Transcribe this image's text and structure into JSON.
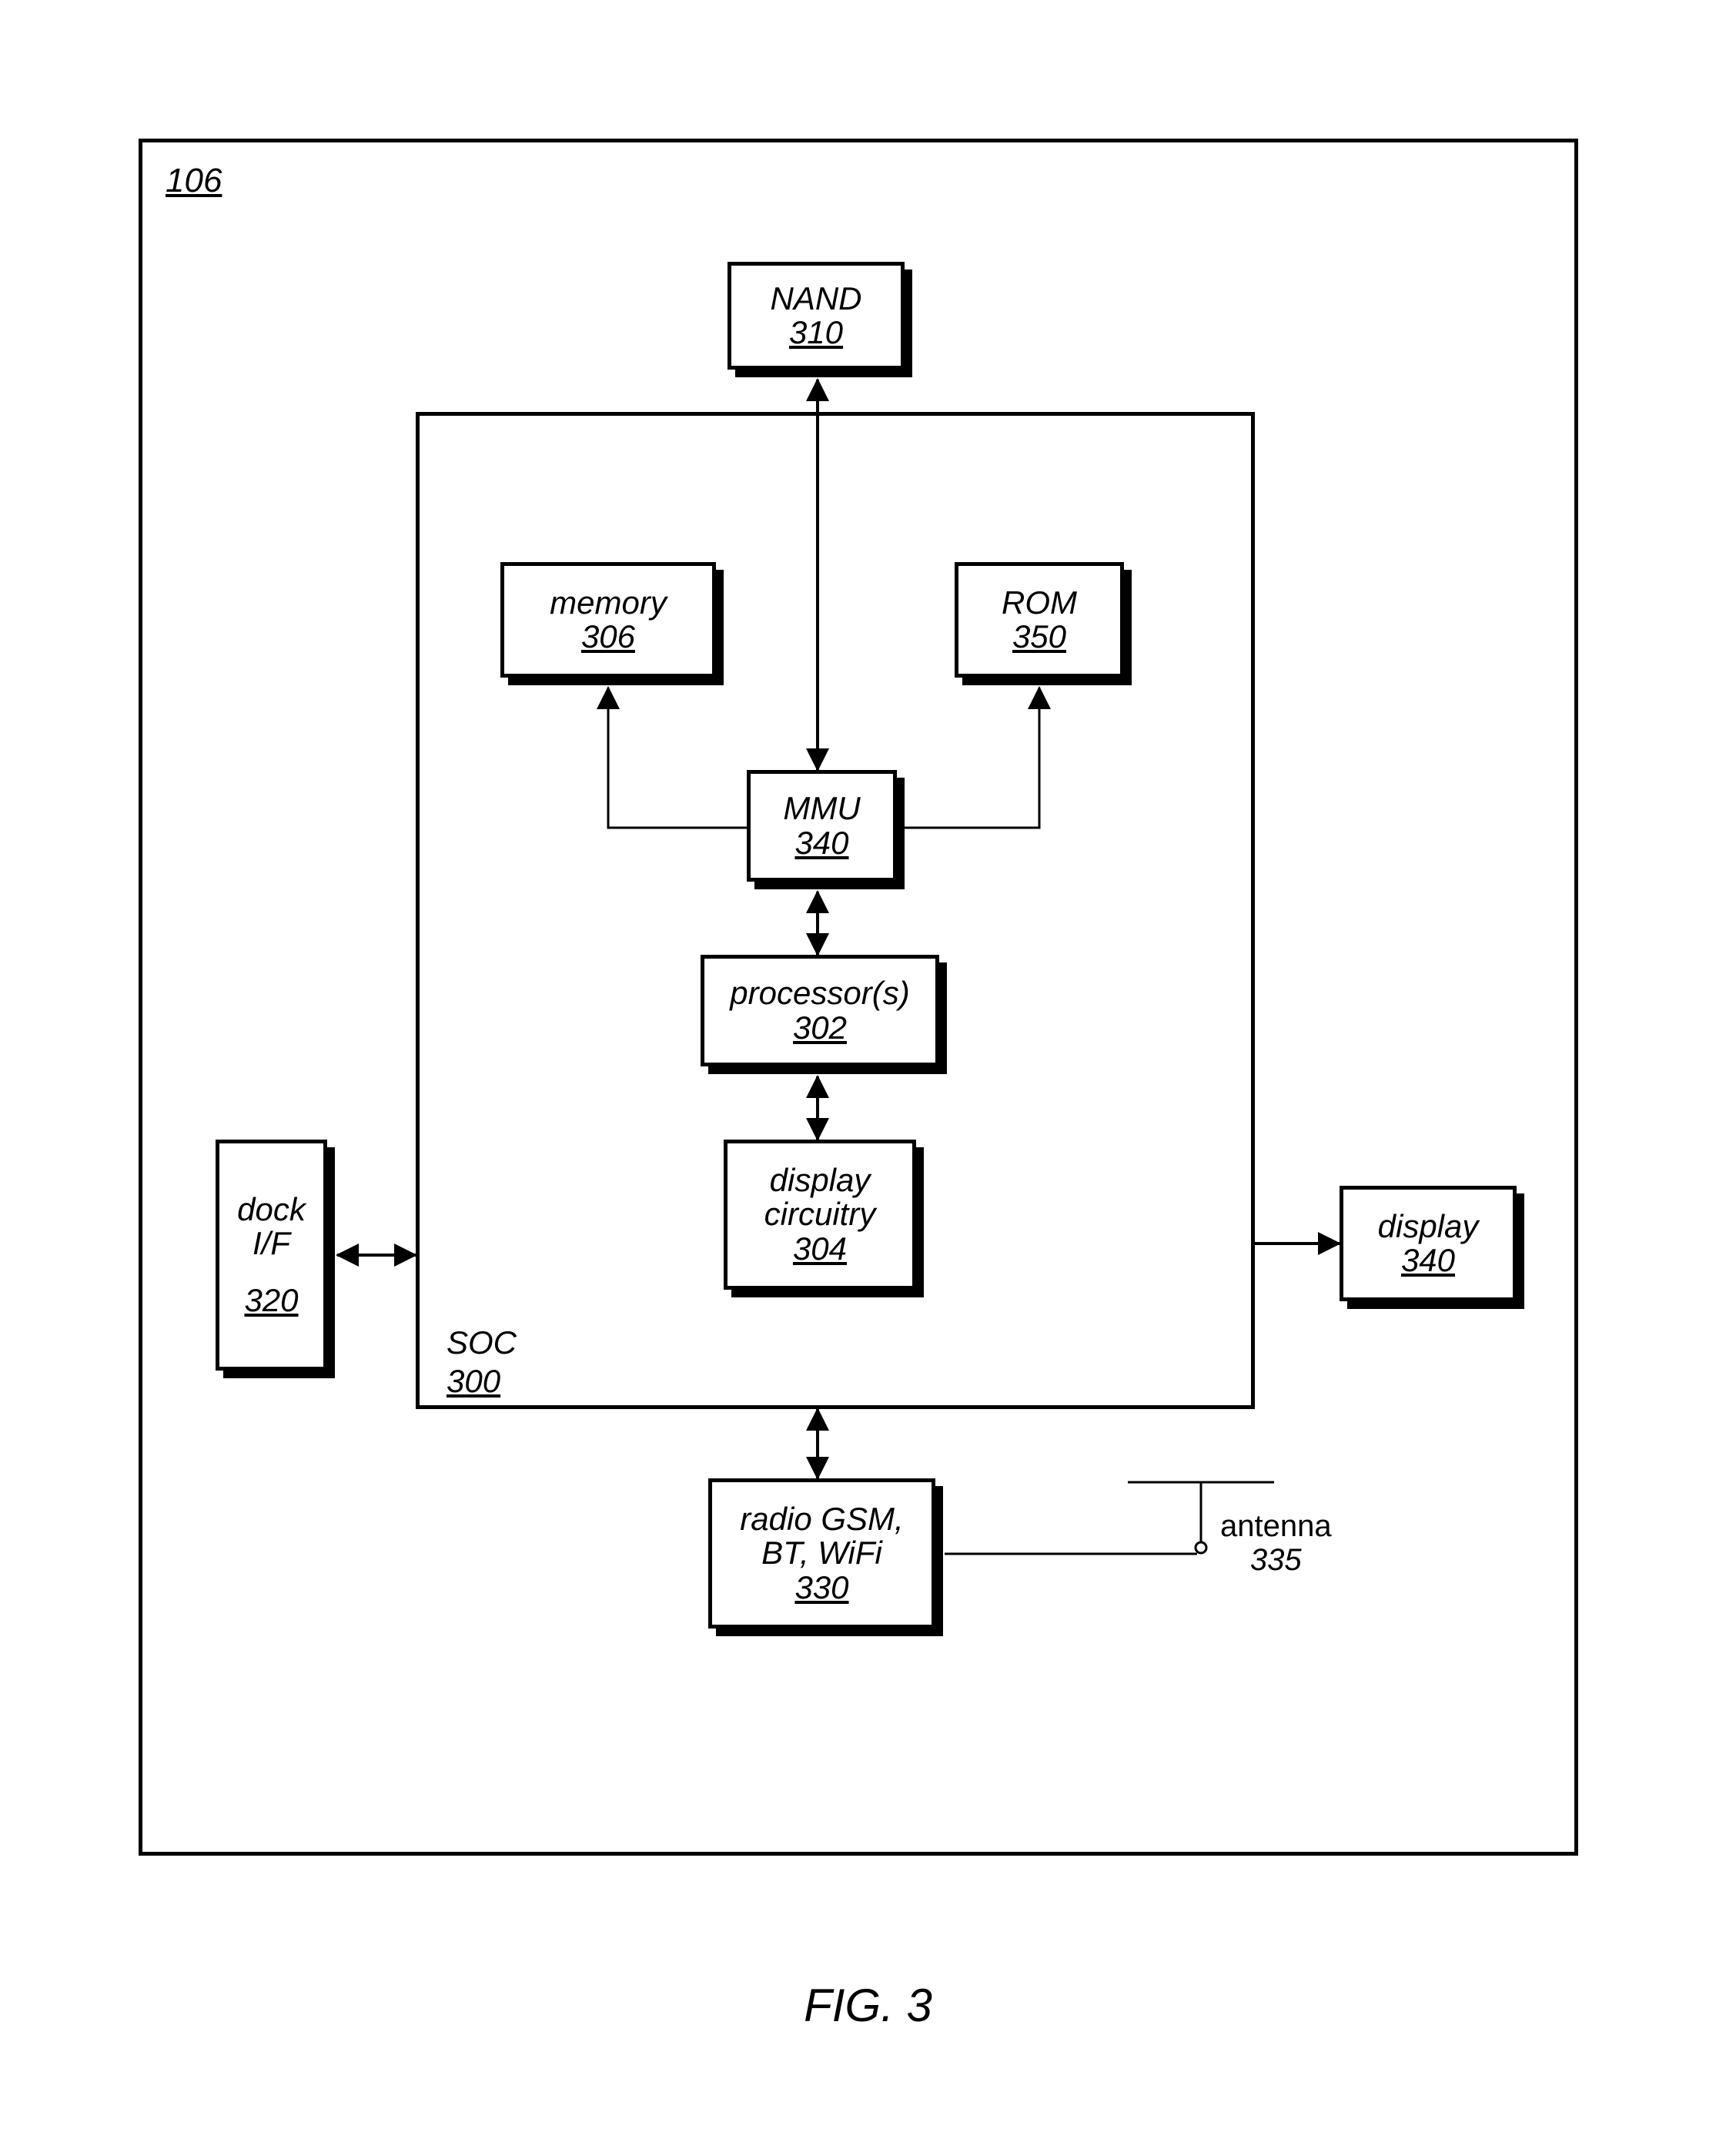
{
  "figure": {
    "caption": "FIG. 3",
    "container_ref": "106"
  },
  "blocks": {
    "nand": {
      "label": "NAND",
      "ref": "310"
    },
    "memory": {
      "label": "memory",
      "ref": "306"
    },
    "rom": {
      "label": "ROM",
      "ref": "350"
    },
    "mmu": {
      "label": "MMU",
      "ref": "340"
    },
    "processor": {
      "label": "processor(s)",
      "ref": "302"
    },
    "display_circ": {
      "label1": "display",
      "label2": "circuitry",
      "ref": "304"
    },
    "dock": {
      "label1": "dock",
      "label2": "I/F",
      "ref": "320"
    },
    "display": {
      "label": "display",
      "ref": "340"
    },
    "radio": {
      "label1": "radio GSM,",
      "label2": "BT, WiFi",
      "ref": "330"
    },
    "soc": {
      "label": "SOC",
      "ref": "300"
    },
    "antenna": {
      "label": "antenna",
      "ref": "335"
    }
  }
}
